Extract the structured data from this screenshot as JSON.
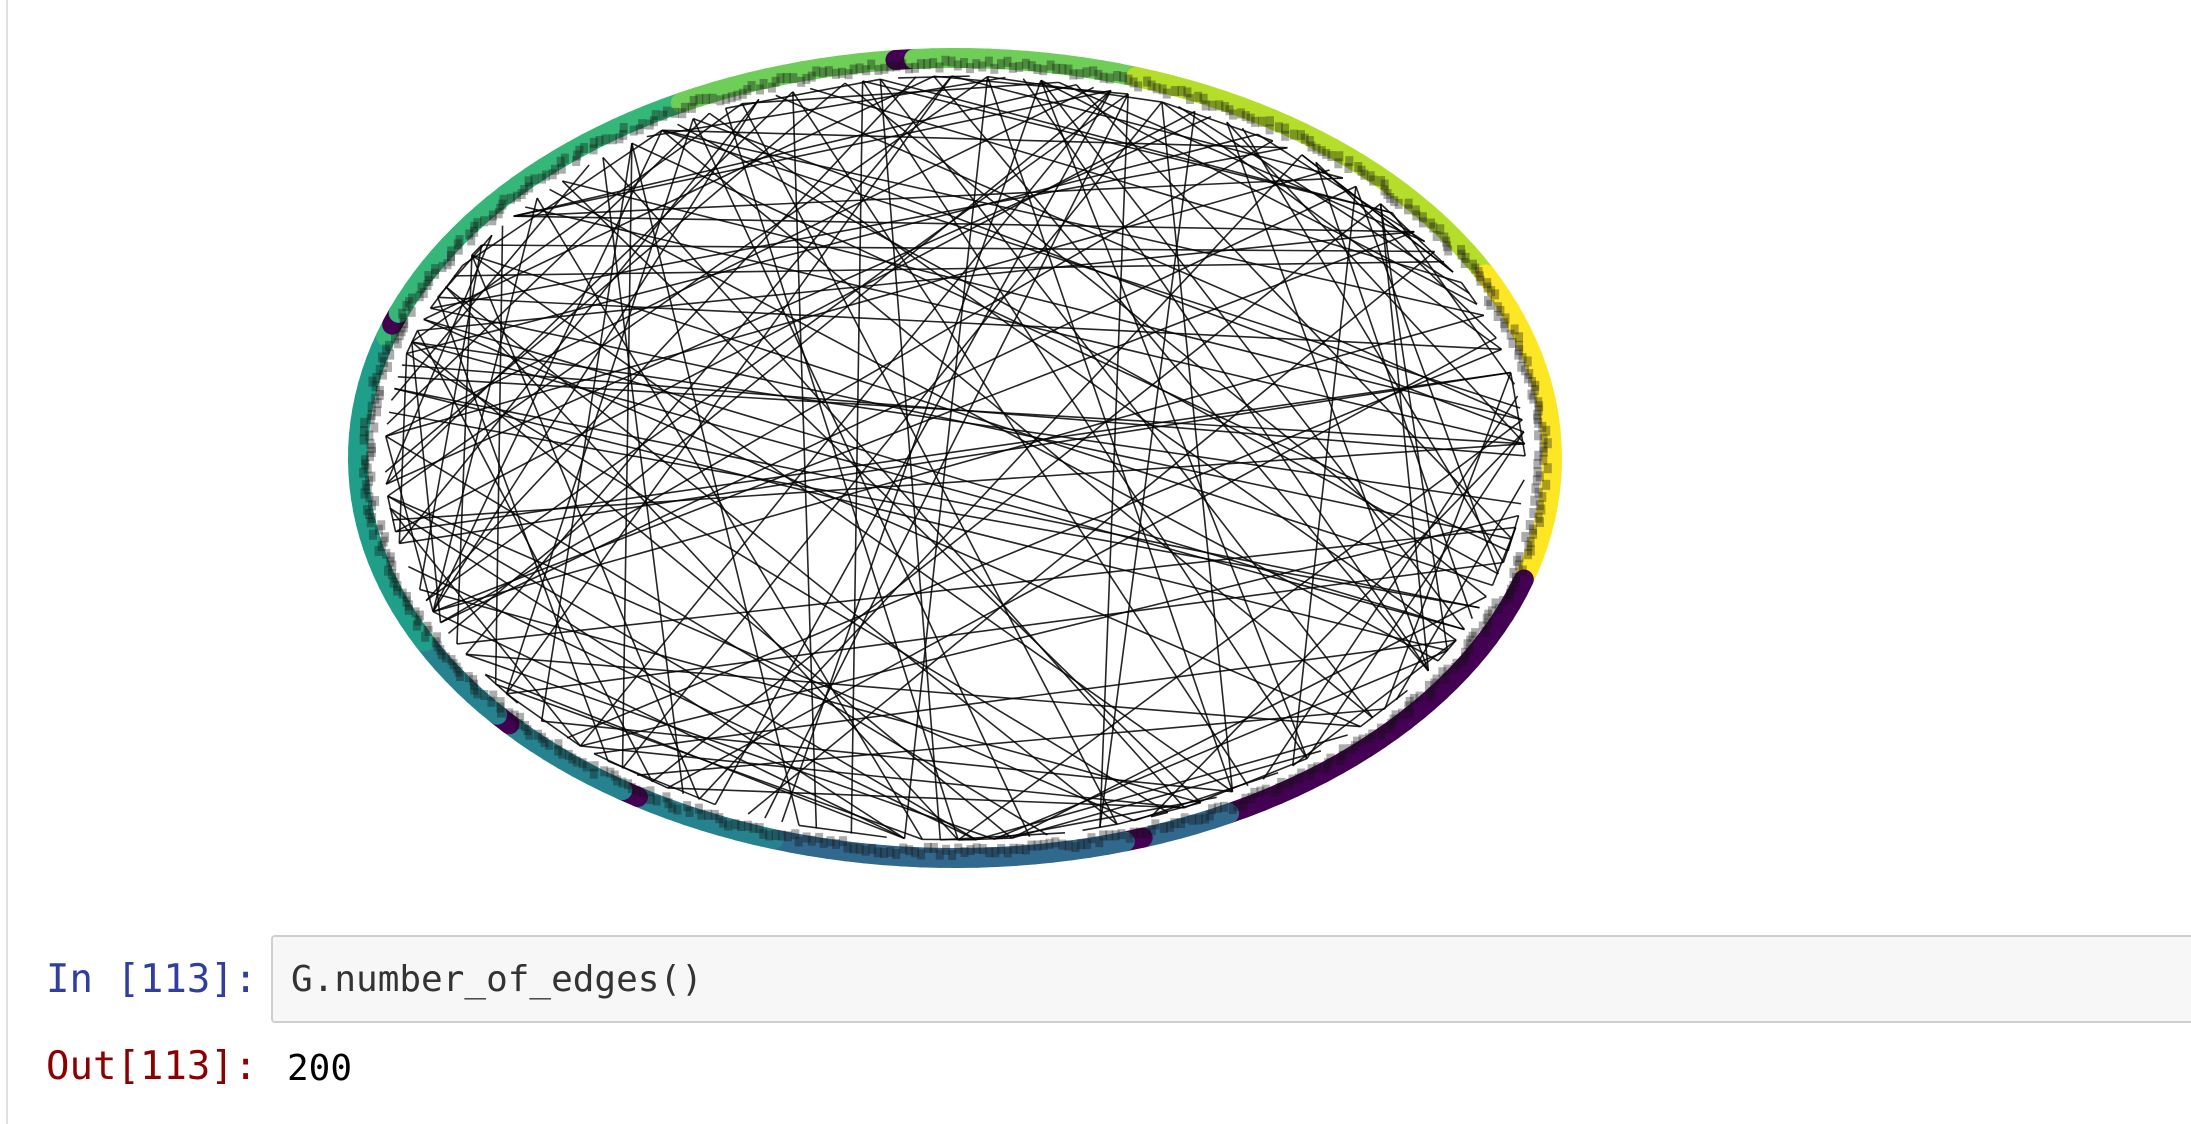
{
  "figure_output": {
    "graph": {
      "layout": "circular",
      "node_count": 200,
      "edge_color": "#000000",
      "node_colormap": [
        "#440154",
        "#31688e",
        "#26828e",
        "#1f9e89",
        "#35b779",
        "#6ece58",
        "#b5de2b",
        "#fde725"
      ]
    }
  },
  "cell_113": {
    "in_prompt": "In [113]:",
    "code": "G.number_of_edges()",
    "out_prompt": "Out[113]:",
    "output": "200"
  }
}
